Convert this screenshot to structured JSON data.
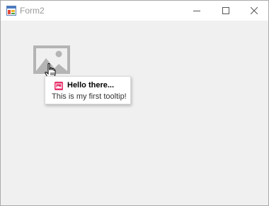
{
  "window": {
    "title": "Form2"
  },
  "tooltip": {
    "title": "Hello there...",
    "text": "This is my first tooltip!"
  },
  "colors": {
    "client_background": "#f0f0f0",
    "titlebar_background": "#ffffff",
    "tooltip_icon": "#e8336d",
    "picture_placeholder": "#b4b4b4"
  },
  "icons": {
    "app": "winforms-app-icon",
    "minimize": "minimize-icon",
    "maximize": "maximize-icon",
    "close": "close-icon",
    "picture": "image-placeholder-icon",
    "cursor": "hand-pointer-cursor",
    "tooltip": "image-icon"
  }
}
